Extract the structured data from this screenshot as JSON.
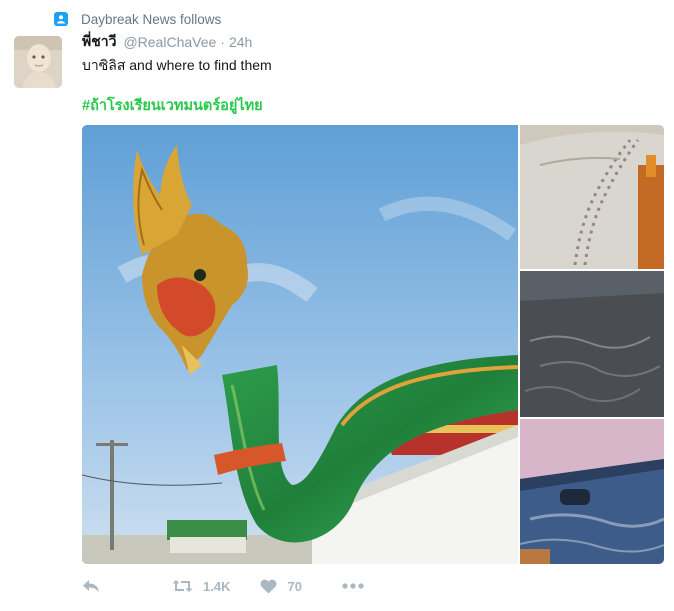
{
  "context": {
    "text": "Daybreak News follows",
    "icon": "person-icon"
  },
  "tweet": {
    "author_name": "พี่ชาวี",
    "handle": "@RealChaVee",
    "separator": "·",
    "time": "24h",
    "text": "บาซิลิส and where to find them",
    "hashtag": "#ถ้าโรงเรียนเวทมนตร์อยู่ไทย"
  },
  "media": [
    {
      "name": "naga-statue-photo"
    },
    {
      "name": "sand-tracks-photo"
    },
    {
      "name": "dusty-car-hood-photo"
    },
    {
      "name": "dusty-car-door-photo"
    }
  ],
  "actions": {
    "reply_icon": "reply-icon",
    "retweet_icon": "retweet-icon",
    "retweets": "1.4K",
    "like_icon": "heart-icon",
    "likes": "70",
    "more_icon": "more-icon"
  },
  "colors": {
    "hashtag": "#2ac94c",
    "context_icon": "#1da1f2",
    "muted": "#aab8c2"
  }
}
